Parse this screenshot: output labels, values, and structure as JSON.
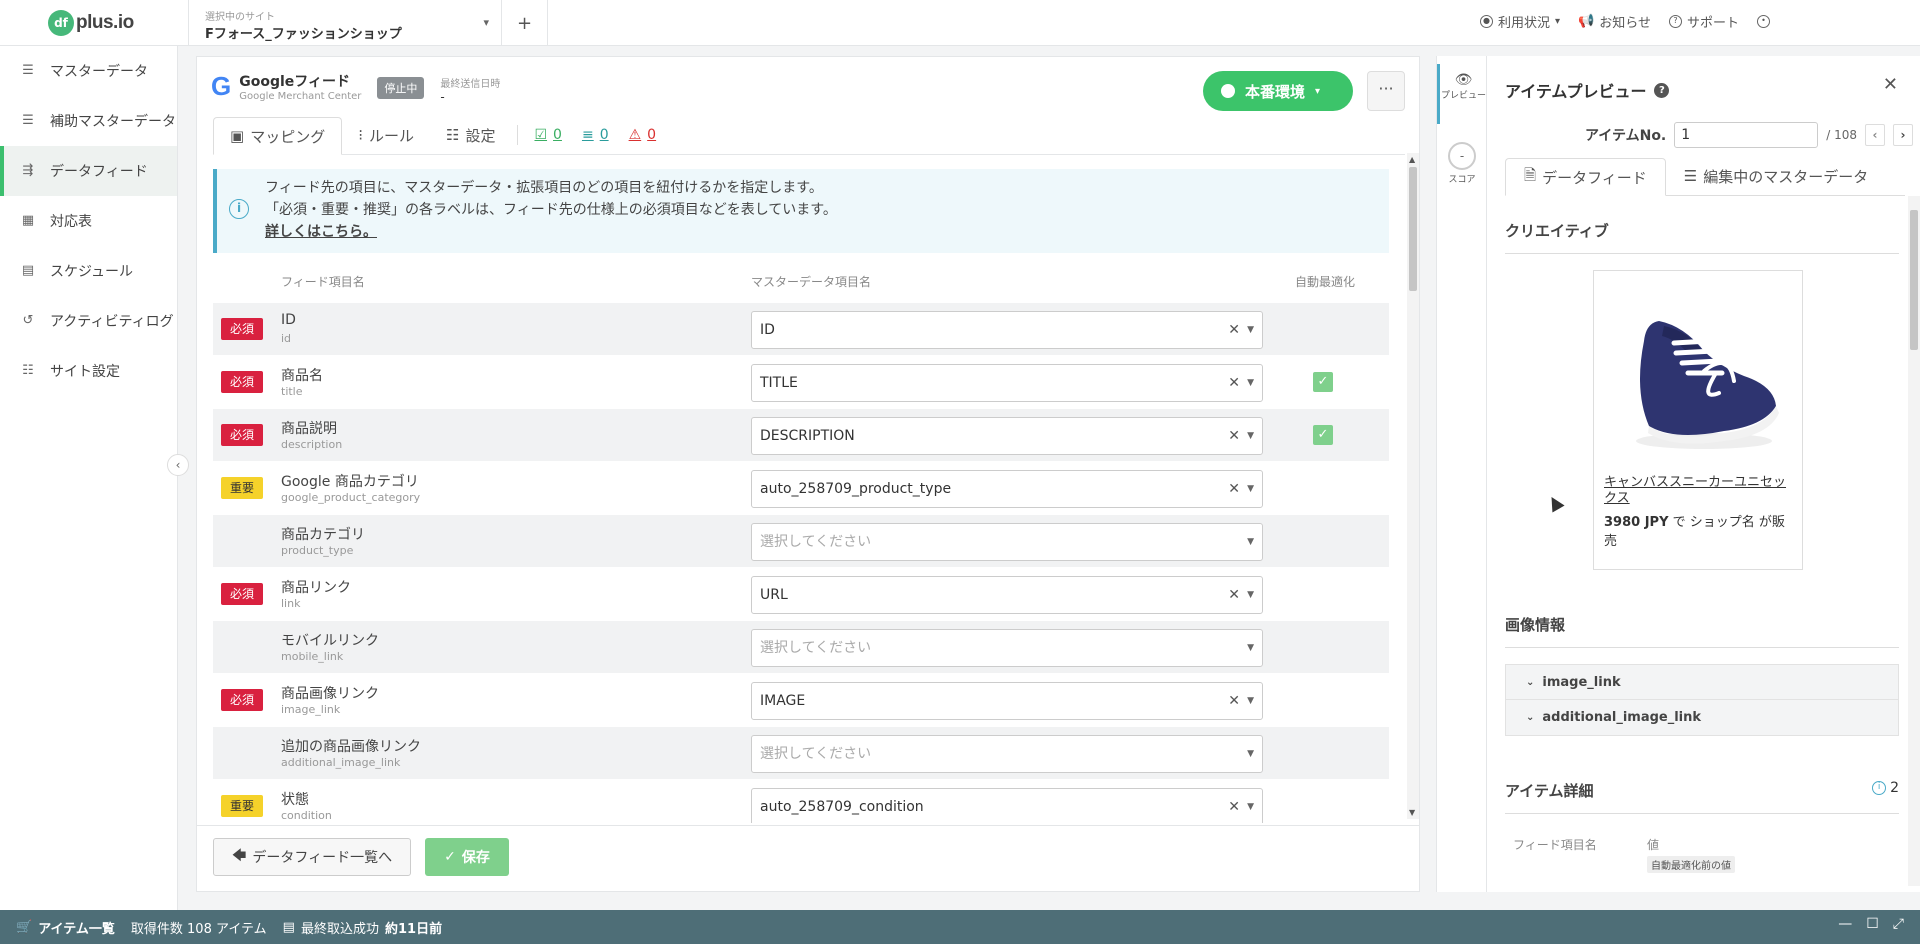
{
  "topbar": {
    "logo_mark": "df",
    "logo_text": "plus.io",
    "site_caption": "選択中のサイト",
    "site_name": "Fフォース_ファッションショップ",
    "add_label": "+",
    "usage": "利用状況",
    "notice": "お知らせ",
    "support": "サポート"
  },
  "sidebar": {
    "items": [
      {
        "label": "マスターデータ",
        "icon": "database-icon"
      },
      {
        "label": "補助マスターデータ",
        "icon": "database-plus-icon"
      },
      {
        "label": "データフィード",
        "icon": "feed-icon",
        "active": true
      },
      {
        "label": "対応表",
        "icon": "table-icon"
      },
      {
        "label": "スケジュール",
        "icon": "calendar-icon"
      },
      {
        "label": "アクティビティログ",
        "icon": "history-icon"
      },
      {
        "label": "サイト設定",
        "icon": "sliders-icon"
      }
    ]
  },
  "feed": {
    "title": "Googleフィード",
    "subtitle": "Google Merchant Center",
    "status": "停止中",
    "last_sent_label": "最終送信日時",
    "last_sent_value": "-",
    "env_button": "本番環境",
    "more": "···"
  },
  "tabs": {
    "mapping": "マッピング",
    "rule": "ルール",
    "settings": "設定",
    "count_ok": "0",
    "count_mid": "0",
    "count_warn": "0"
  },
  "info": {
    "line1": "フィード先の項目に、マスターデータ・拡張項目のどの項目を紐付けるかを指定します。",
    "line2": "「必須・重要・推奨」の各ラベルは、フィード先の仕様上の必須項目などを表しています。",
    "link": "詳しくはこちら。"
  },
  "columns": {
    "feed_item": "フィード項目名",
    "master_item": "マスターデータ項目名",
    "auto_opt": "自動最適化"
  },
  "rows": [
    {
      "badge": "必須",
      "badge_type": "req",
      "name": "ID",
      "key": "id",
      "value": "ID",
      "empty": false,
      "auto": false
    },
    {
      "badge": "必須",
      "badge_type": "req",
      "name": "商品名",
      "key": "title",
      "value": "TITLE",
      "empty": false,
      "auto": true
    },
    {
      "badge": "必須",
      "badge_type": "req",
      "name": "商品説明",
      "key": "description",
      "value": "DESCRIPTION",
      "empty": false,
      "auto": true
    },
    {
      "badge": "重要",
      "badge_type": "imp",
      "name": "Google 商品カテゴリ",
      "key": "google_product_category",
      "value": "auto_258709_product_type",
      "empty": false,
      "auto": false
    },
    {
      "badge": "",
      "badge_type": "",
      "name": "商品カテゴリ",
      "key": "product_type",
      "value": "選択してください",
      "empty": true,
      "auto": false
    },
    {
      "badge": "必須",
      "badge_type": "req",
      "name": "商品リンク",
      "key": "link",
      "value": "URL",
      "empty": false,
      "auto": false
    },
    {
      "badge": "",
      "badge_type": "",
      "name": "モバイルリンク",
      "key": "mobile_link",
      "value": "選択してください",
      "empty": true,
      "auto": false
    },
    {
      "badge": "必須",
      "badge_type": "req",
      "name": "商品画像リンク",
      "key": "image_link",
      "value": "IMAGE",
      "empty": false,
      "auto": false
    },
    {
      "badge": "",
      "badge_type": "",
      "name": "追加の商品画像リンク",
      "key": "additional_image_link",
      "value": "選択してください",
      "empty": true,
      "auto": false
    },
    {
      "badge": "重要",
      "badge_type": "imp",
      "name": "状態",
      "key": "condition",
      "value": "auto_258709_condition",
      "empty": false,
      "auto": false
    }
  ],
  "footer": {
    "back": "データフィード一覧へ",
    "save": "保存"
  },
  "rail": {
    "preview": "プレビュー",
    "score": "スコア",
    "score_value": "-"
  },
  "preview": {
    "title": "アイテムプレビュー",
    "item_no_label": "アイテムNo.",
    "item_no_value": "1",
    "item_total": "/ 108",
    "tab_feed": "データフィード",
    "tab_master": "編集中のマスターデータ",
    "creative_title": "クリエイティブ",
    "product_name": "キャンバススニーカーユニセックス",
    "price": "3980 JPY",
    "price_rest": "で ショップ名 が販売",
    "image_info_title": "画像情報",
    "acc1": "image_link",
    "acc2": "additional_image_link",
    "details_title": "アイテム詳細",
    "details_count": "2",
    "detail_col1": "フィード項目名",
    "detail_col2": "値",
    "detail_sub": "自動最適化前の値"
  },
  "bottom": {
    "items_label": "アイテム一覧",
    "count_text": "取得件数 108 アイテム",
    "last_import": "最終取込成功",
    "last_import_ago": "約11日前"
  },
  "colors": {
    "accent_green": "#3cc46a",
    "required_red": "#d9213f",
    "important_yellow": "#f5d22a",
    "bottom_bar": "#4e6e77"
  }
}
